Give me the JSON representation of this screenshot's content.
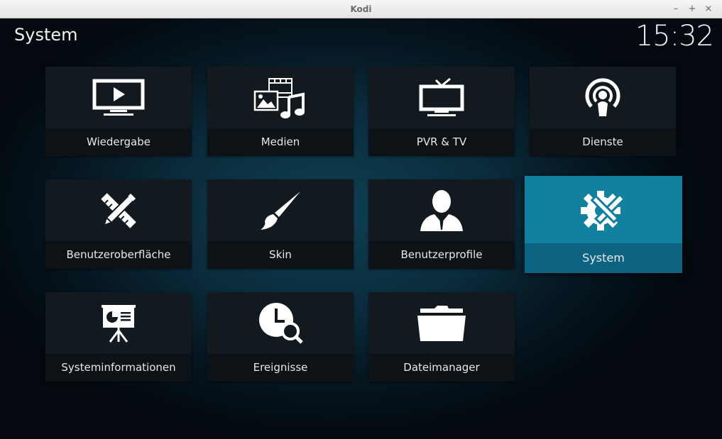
{
  "window": {
    "title": "Kodi",
    "minimize": "–",
    "maximize": "+",
    "close": "×"
  },
  "header": {
    "title": "System",
    "clock": "15:32"
  },
  "tiles": [
    {
      "label": "Wiedergabe",
      "icon": "tv-play-icon"
    },
    {
      "label": "Medien",
      "icon": "media-icon"
    },
    {
      "label": "PVR & TV",
      "icon": "pvr-tv-icon"
    },
    {
      "label": "Dienste",
      "icon": "services-icon"
    },
    {
      "label": "Benutzeroberfläche",
      "icon": "interface-icon"
    },
    {
      "label": "Skin",
      "icon": "brush-icon"
    },
    {
      "label": "Benutzerprofile",
      "icon": "profile-icon"
    },
    {
      "label": "System",
      "icon": "system-gear-icon",
      "focused": true
    },
    {
      "label": "Systeminformationen",
      "icon": "system-info-icon"
    },
    {
      "label": "Ereignisse",
      "icon": "events-clock-icon"
    },
    {
      "label": "Dateimanager",
      "icon": "folder-icon"
    }
  ],
  "colors": {
    "focus": "#12809f",
    "tile": "#121a1f"
  }
}
